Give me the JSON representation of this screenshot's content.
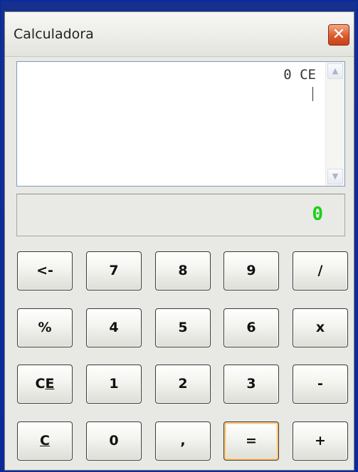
{
  "window": {
    "title": "Calculadora",
    "close_icon": "close-icon"
  },
  "log": {
    "text": "0 CE"
  },
  "display": {
    "value": "0",
    "color": "#18d018"
  },
  "keys": {
    "backspace": "<-",
    "seven": "7",
    "eight": "8",
    "nine": "9",
    "divide": "/",
    "percent": "%",
    "four": "4",
    "five": "5",
    "six": "6",
    "multiply": "x",
    "clear_entry_a": "C",
    "clear_entry_b": "E",
    "one": "1",
    "two": "2",
    "three": "3",
    "minus": "-",
    "clear": "C",
    "zero": "0",
    "decimal": ",",
    "equals": "=",
    "plus": "+"
  }
}
